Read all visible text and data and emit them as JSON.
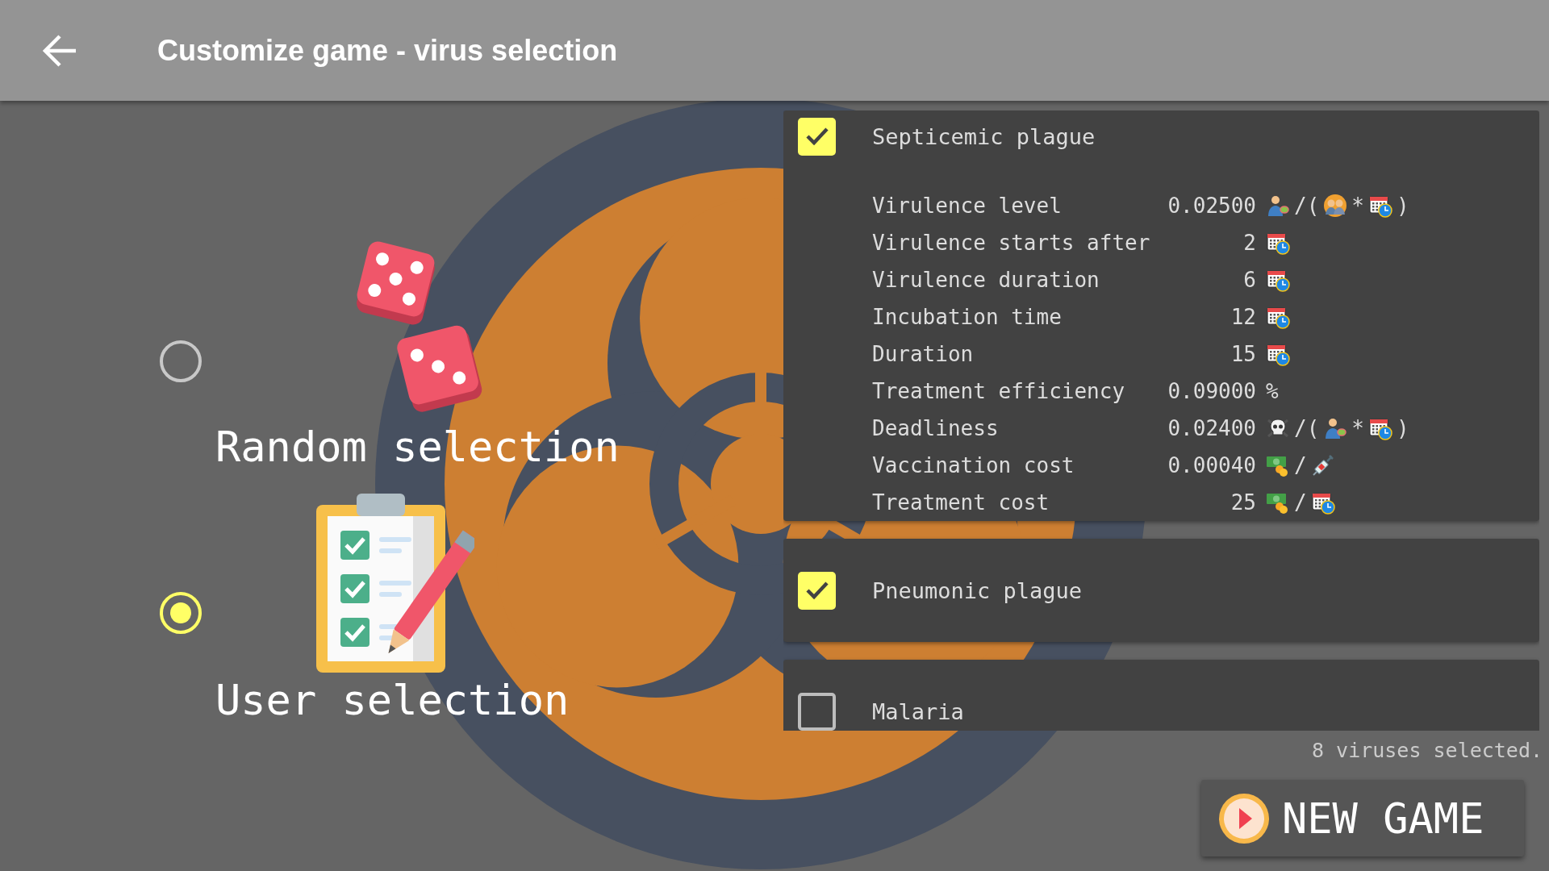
{
  "header": {
    "title": "Customize game - virus selection"
  },
  "options": [
    {
      "label": "Random selection",
      "selected": false,
      "kind": "dice"
    },
    {
      "label": "User selection",
      "selected": true,
      "kind": "clipboard"
    }
  ],
  "viruses": [
    {
      "name": "Septicemic plague",
      "checked": true,
      "stats": [
        {
          "label": "Virulence level",
          "value": "0.02500",
          "unit": [
            {
              "kind": "person"
            },
            {
              "kind": "text",
              "text": "/("
            },
            {
              "kind": "crowd"
            },
            {
              "kind": "text",
              "text": "*"
            },
            {
              "kind": "calendar"
            },
            {
              "kind": "text",
              "text": ")"
            }
          ]
        },
        {
          "label": "Virulence starts after",
          "value": "2",
          "unit": [
            {
              "kind": "calendar"
            }
          ]
        },
        {
          "label": "Virulence duration",
          "value": "6",
          "unit": [
            {
              "kind": "calendar"
            }
          ]
        },
        {
          "label": "Incubation time",
          "value": "12",
          "unit": [
            {
              "kind": "calendar"
            }
          ]
        },
        {
          "label": "Duration",
          "value": "15",
          "unit": [
            {
              "kind": "calendar"
            }
          ]
        },
        {
          "label": "Treatment efficiency",
          "value": "0.09000",
          "unit": [
            {
              "kind": "text",
              "text": "%"
            }
          ]
        },
        {
          "label": "Deadliness",
          "value": "0.02400",
          "unit": [
            {
              "kind": "skull"
            },
            {
              "kind": "text",
              "text": "/("
            },
            {
              "kind": "person"
            },
            {
              "kind": "text",
              "text": "*"
            },
            {
              "kind": "calendar"
            },
            {
              "kind": "text",
              "text": ")"
            }
          ]
        },
        {
          "label": "Vaccination cost",
          "value": "0.00040",
          "unit": [
            {
              "kind": "money"
            },
            {
              "kind": "text",
              "text": "/"
            },
            {
              "kind": "syringe"
            }
          ]
        },
        {
          "label": "Treatment cost",
          "value": "25",
          "unit": [
            {
              "kind": "money"
            },
            {
              "kind": "text",
              "text": "/"
            },
            {
              "kind": "calendar"
            }
          ]
        }
      ]
    },
    {
      "name": "Pneumonic plague",
      "checked": true
    },
    {
      "name": "Malaria",
      "checked": false
    }
  ],
  "status": "8 viruses selected.",
  "new_game_button": {
    "label": "NEW GAME"
  }
}
